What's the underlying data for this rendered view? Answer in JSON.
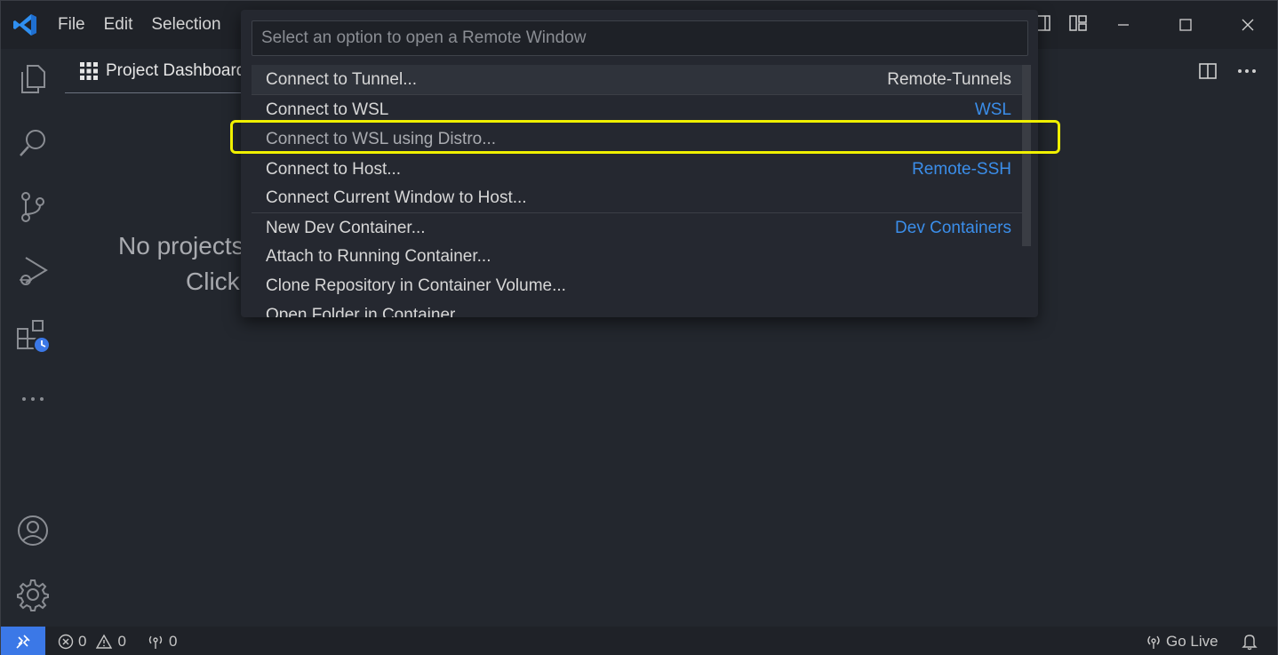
{
  "menu": [
    "File",
    "Edit",
    "Selection"
  ],
  "tab": {
    "label": "Project Dashboard"
  },
  "editor": {
    "line1": "No projects",
    "line2": "Click"
  },
  "quickpick": {
    "placeholder": "Select an option to open a Remote Window",
    "items": [
      {
        "label": "Connect to Tunnel...",
        "detail": "Remote-Tunnels"
      },
      {
        "label": "Connect to WSL",
        "detail": "WSL"
      },
      {
        "label": "Connect to WSL using Distro...",
        "detail": ""
      },
      {
        "label": "Connect to Host...",
        "detail": "Remote-SSH"
      },
      {
        "label": "Connect Current Window to Host...",
        "detail": ""
      },
      {
        "label": "New Dev Container...",
        "detail": "Dev Containers"
      },
      {
        "label": "Attach to Running Container...",
        "detail": ""
      },
      {
        "label": "Clone Repository in Container Volume...",
        "detail": ""
      },
      {
        "label": "Open Folder in Container...",
        "detail": ""
      }
    ]
  },
  "statusbar": {
    "errors": "0",
    "warnings": "0",
    "ports": "0",
    "golive": "Go Live"
  },
  "colors": {
    "accent": "#3b78e7",
    "link": "#3b8eea",
    "highlight": "#f0f000"
  }
}
